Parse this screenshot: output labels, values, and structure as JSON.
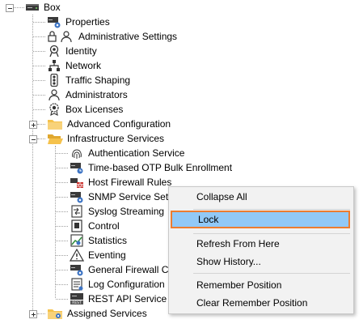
{
  "tree": {
    "root": {
      "label": "Box",
      "icon": "server-box-icon"
    },
    "items": [
      {
        "label": "Properties",
        "icon": "server-settings-icon"
      },
      {
        "label": "Administrative Settings",
        "icon": "lock-user-icon"
      },
      {
        "label": "Identity",
        "icon": "certificate-badge-icon"
      },
      {
        "label": "Network",
        "icon": "network-tree-icon"
      },
      {
        "label": "Traffic Shaping",
        "icon": "traffic-light-icon"
      },
      {
        "label": "Administrators",
        "icon": "user-icon"
      },
      {
        "label": "Box Licenses",
        "icon": "license-seal-icon"
      },
      {
        "label": "Advanced Configuration",
        "icon": "folder-icon"
      },
      {
        "label": "Infrastructure Services",
        "icon": "folder-open-icon"
      },
      {
        "label": "Authentication Service",
        "icon": "fingerprint-icon"
      },
      {
        "label": "Time-based OTP Bulk Enrollment",
        "icon": "server-clock-icon"
      },
      {
        "label": "Host Firewall Rules",
        "icon": "firewall-icon"
      },
      {
        "label": "SNMP Service Setti",
        "icon": "server-gear-icon"
      },
      {
        "label": "Syslog Streaming",
        "icon": "document-arrow-icon"
      },
      {
        "label": "Control",
        "icon": "control-panel-icon"
      },
      {
        "label": "Statistics",
        "icon": "chart-icon"
      },
      {
        "label": "Eventing",
        "icon": "warning-icon"
      },
      {
        "label": "General Firewall Co",
        "icon": "server-gear-icon"
      },
      {
        "label": "Log Configuration",
        "icon": "log-document-icon"
      },
      {
        "label": "REST API Service",
        "icon": "rest-api-icon"
      },
      {
        "label": "Assigned Services",
        "icon": "folder-gear-icon"
      }
    ]
  },
  "context_menu": {
    "items": [
      {
        "label": "Collapse All"
      },
      {
        "label": "Lock",
        "highlighted": true
      },
      {
        "label": "Refresh From Here"
      },
      {
        "label": "Show History..."
      },
      {
        "label": "Remember Position"
      },
      {
        "label": "Clear Remember Position"
      }
    ]
  },
  "colors": {
    "highlight": "#91c9f7",
    "highlight_border": "#ec7d31",
    "folder": "#f5c24c"
  }
}
